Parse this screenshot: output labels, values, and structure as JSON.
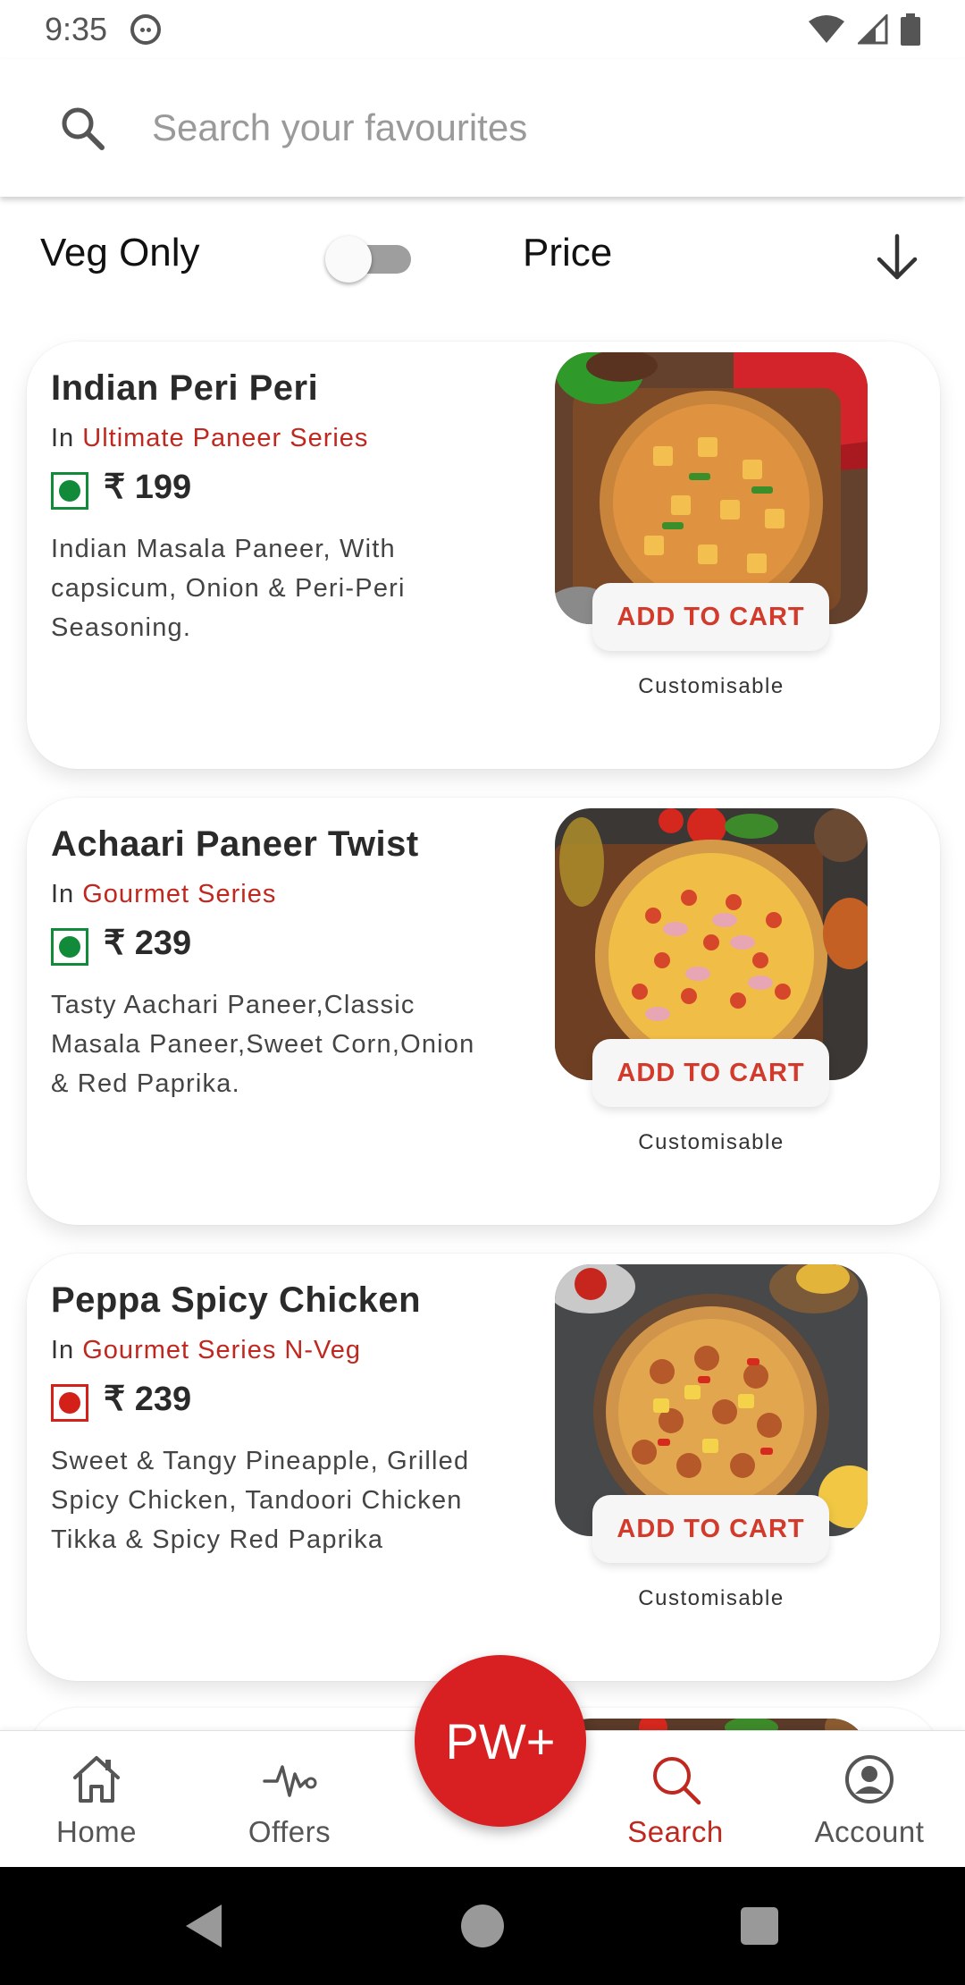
{
  "status_bar": {
    "time": "9:35"
  },
  "search": {
    "placeholder": "Search your favourites"
  },
  "filters": {
    "veg_only_label": "Veg Only",
    "veg_only_on": false,
    "sort_label": "Price",
    "sort_direction": "descending"
  },
  "products": [
    {
      "name": "Indian Peri Peri",
      "series_prefix": "In",
      "series": "Ultimate Paneer Series",
      "diet": "veg",
      "price": "₹ 199",
      "description": "Indian Masala Paneer, With capsicum, Onion & Peri-Peri Seasoning.",
      "cta": "ADD TO CART",
      "customisable": "Customisable"
    },
    {
      "name": "Achaari Paneer Twist",
      "series_prefix": "In",
      "series": "Gourmet Series",
      "diet": "veg",
      "price": "₹ 239",
      "description": "Tasty Aachari Paneer,Classic Masala Paneer,Sweet Corn,Onion & Red Paprika.",
      "cta": "ADD TO CART",
      "customisable": "Customisable"
    },
    {
      "name": "Peppa Spicy Chicken",
      "series_prefix": "In",
      "series": "Gourmet Series N-Veg",
      "diet": "non-veg",
      "price": "₹ 239",
      "description": "Sweet & Tangy Pineapple, Grilled Spicy Chicken, Tandoori Chicken Tikka & Spicy Red Paprika",
      "cta": "ADD TO CART",
      "customisable": "Customisable"
    }
  ],
  "fab": {
    "label": "PW+"
  },
  "bottom_nav": {
    "items": [
      {
        "label": "Home",
        "icon": "home-icon",
        "active": false
      },
      {
        "label": "Offers",
        "icon": "pulse-icon",
        "active": false
      },
      {
        "label": "Search",
        "icon": "search-icon",
        "active": true
      },
      {
        "label": "Account",
        "icon": "account-icon",
        "active": false
      }
    ]
  },
  "colors": {
    "brand_red": "#d82022",
    "accent_text": "#c0271f",
    "veg_green": "#118a3a",
    "nonveg_red": "#d3211a"
  }
}
